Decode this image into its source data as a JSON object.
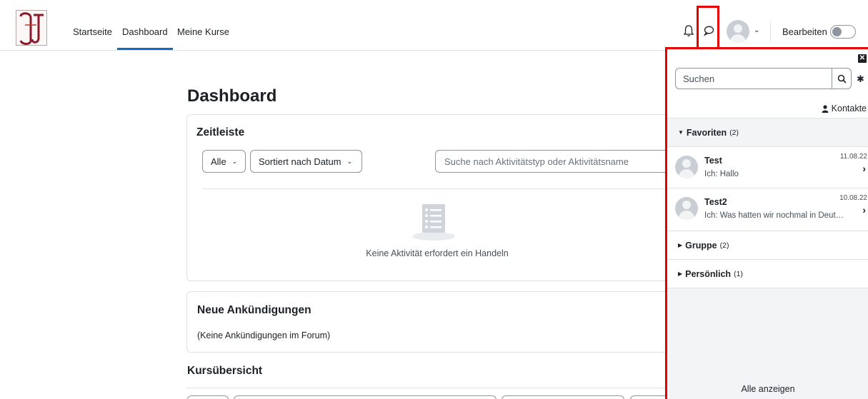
{
  "navbar": {
    "links": [
      "Startseite",
      "Dashboard",
      "Meine Kurse"
    ],
    "active_link": "Dashboard",
    "icons": [
      "bell-icon",
      "chat-bubble-icon",
      "user-avatar",
      "chevron-down-icon"
    ],
    "edit_label": "Bearbeiten",
    "edit_mode_on": false
  },
  "main": {
    "title": "Dashboard",
    "timeline": {
      "title": "Zeitleiste",
      "filter_label": "Alle",
      "sort_label": "Sortiert nach Datum",
      "search_placeholder": "Suche nach Aktivitätstyp oder Aktivitätsname",
      "empty_text": "Keine Aktivität erfordert ein Handeln"
    },
    "announcements": {
      "title": "Neue Ankündigungen",
      "text": "(Keine Ankündigungen im Forum)"
    },
    "course_overview": {
      "title": "Kursübersicht"
    }
  },
  "drawer": {
    "search_placeholder": "Suchen",
    "contacts_label": "Kontakte",
    "favorites": {
      "label": "Favoriten",
      "count": "(2)"
    },
    "conversations": [
      {
        "name": "Test",
        "message": "Ich: Hallo",
        "date": "11.08.22"
      },
      {
        "name": "Test2",
        "message": "Ich: Was hatten wir nochmal in Deutsch auf?",
        "date": "10.08.22"
      }
    ],
    "group": {
      "label": "Gruppe",
      "count": "(2)"
    },
    "personal": {
      "label": "Persönlich",
      "count": "(1)"
    },
    "show_all": "Alle anzeigen"
  },
  "colors": {
    "accent": "#0f6cbf",
    "highlight_border": "#e60000"
  }
}
